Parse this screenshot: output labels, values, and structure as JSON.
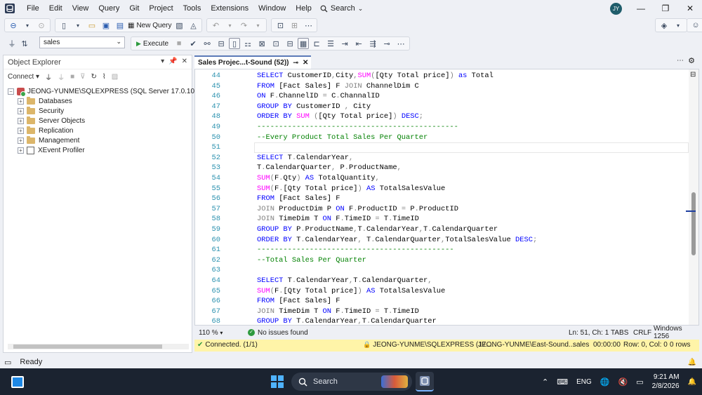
{
  "menu": [
    "File",
    "Edit",
    "View",
    "Query",
    "Git",
    "Project",
    "Tools",
    "Extensions",
    "Window",
    "Help"
  ],
  "search_label": "Search",
  "user_initials": "JY",
  "toolbar": {
    "new_query_label": "New Query",
    "database": "sales",
    "execute_label": "Execute"
  },
  "object_explorer": {
    "title": "Object Explorer",
    "connect_label": "Connect",
    "server": "JEONG-YUNME\\SQLEXPRESS (SQL Server 17.0.1050 - JEO",
    "nodes": [
      "Databases",
      "Security",
      "Server Objects",
      "Replication",
      "Management",
      "XEvent Profiler"
    ]
  },
  "tab_title": "Sales Projec...t-Sound (52))",
  "editor_lines": [
    {
      "n": "44",
      "t": [
        [
          "kw",
          "SELECT "
        ],
        [
          "tx",
          "CustomerID"
        ],
        [
          "gr",
          ","
        ],
        [
          "tx",
          "City"
        ],
        [
          "gr",
          ","
        ],
        [
          "fn",
          "SUM"
        ],
        [
          "gr",
          "("
        ],
        [
          "tx",
          "[Qty Total price]"
        ],
        [
          "gr",
          ") "
        ],
        [
          "kw",
          "as "
        ],
        [
          "tx",
          "Total"
        ]
      ]
    },
    {
      "n": "45",
      "t": [
        [
          "kw",
          "FROM "
        ],
        [
          "tx",
          "[Fact Sales] F "
        ],
        [
          "gr",
          "JOIN "
        ],
        [
          "tx",
          "ChannelDim C"
        ]
      ]
    },
    {
      "n": "46",
      "t": [
        [
          "kw",
          "ON "
        ],
        [
          "tx",
          "F"
        ],
        [
          "gr",
          "."
        ],
        [
          "tx",
          "ChannelID "
        ],
        [
          "gr",
          "= "
        ],
        [
          "tx",
          "C"
        ],
        [
          "gr",
          "."
        ],
        [
          "tx",
          "ChannalID"
        ]
      ]
    },
    {
      "n": "47",
      "t": [
        [
          "kw",
          "GROUP BY "
        ],
        [
          "tx",
          "CustomerID "
        ],
        [
          "gr",
          ", "
        ],
        [
          "tx",
          "City"
        ]
      ]
    },
    {
      "n": "48",
      "t": [
        [
          "kw",
          "ORDER BY "
        ],
        [
          "fn",
          "SUM "
        ],
        [
          "gr",
          "("
        ],
        [
          "tx",
          "[Qty Total price]"
        ],
        [
          "gr",
          ") "
        ],
        [
          "kw",
          "DESC"
        ],
        [
          "gr",
          ";"
        ]
      ]
    },
    {
      "n": "49",
      "t": [
        [
          "cm",
          "----------------------------------------------"
        ]
      ]
    },
    {
      "n": "50",
      "t": [
        [
          "cm",
          "--Every Product Total Sales Per Quarter"
        ]
      ]
    },
    {
      "n": "51",
      "t": []
    },
    {
      "n": "52",
      "t": [
        [
          "kw",
          "SELECT "
        ],
        [
          "tx",
          "T"
        ],
        [
          "gr",
          "."
        ],
        [
          "tx",
          "CalendarYear"
        ],
        [
          "gr",
          ","
        ]
      ]
    },
    {
      "n": "53",
      "t": [
        [
          "tx",
          "T"
        ],
        [
          "gr",
          "."
        ],
        [
          "tx",
          "CalendarQuarter"
        ],
        [
          "gr",
          ", "
        ],
        [
          "tx",
          "P"
        ],
        [
          "gr",
          "."
        ],
        [
          "tx",
          "ProductName"
        ],
        [
          "gr",
          ","
        ]
      ]
    },
    {
      "n": "54",
      "t": [
        [
          "fn",
          "SUM"
        ],
        [
          "gr",
          "("
        ],
        [
          "tx",
          "F"
        ],
        [
          "gr",
          "."
        ],
        [
          "tx",
          "Qty"
        ],
        [
          "gr",
          ") "
        ],
        [
          "kw",
          "AS "
        ],
        [
          "tx",
          "TotalQuantity"
        ],
        [
          "gr",
          ","
        ]
      ]
    },
    {
      "n": "55",
      "t": [
        [
          "fn",
          "SUM"
        ],
        [
          "gr",
          "("
        ],
        [
          "tx",
          "F"
        ],
        [
          "gr",
          "."
        ],
        [
          "tx",
          "[Qty Total price]"
        ],
        [
          "gr",
          ") "
        ],
        [
          "kw",
          "AS "
        ],
        [
          "tx",
          "TotalSalesValue"
        ]
      ]
    },
    {
      "n": "56",
      "t": [
        [
          "kw",
          "FROM "
        ],
        [
          "tx",
          "[Fact Sales] F"
        ]
      ]
    },
    {
      "n": "57",
      "t": [
        [
          "gr",
          "JOIN "
        ],
        [
          "tx",
          "ProductDim P "
        ],
        [
          "kw",
          "ON "
        ],
        [
          "tx",
          "F"
        ],
        [
          "gr",
          "."
        ],
        [
          "tx",
          "ProductID "
        ],
        [
          "gr",
          "= "
        ],
        [
          "tx",
          "P"
        ],
        [
          "gr",
          "."
        ],
        [
          "tx",
          "ProductID"
        ]
      ]
    },
    {
      "n": "58",
      "t": [
        [
          "gr",
          "JOIN "
        ],
        [
          "tx",
          "TimeDim T "
        ],
        [
          "kw",
          "ON "
        ],
        [
          "tx",
          "F"
        ],
        [
          "gr",
          "."
        ],
        [
          "tx",
          "TimeID "
        ],
        [
          "gr",
          "= "
        ],
        [
          "tx",
          "T"
        ],
        [
          "gr",
          "."
        ],
        [
          "tx",
          "TimeID"
        ]
      ]
    },
    {
      "n": "59",
      "t": [
        [
          "kw",
          "GROUP BY "
        ],
        [
          "tx",
          "P"
        ],
        [
          "gr",
          "."
        ],
        [
          "tx",
          "ProductName"
        ],
        [
          "gr",
          ","
        ],
        [
          "tx",
          "T"
        ],
        [
          "gr",
          "."
        ],
        [
          "tx",
          "CalendarYear"
        ],
        [
          "gr",
          ","
        ],
        [
          "tx",
          "T"
        ],
        [
          "gr",
          "."
        ],
        [
          "tx",
          "CalendarQuarter"
        ]
      ]
    },
    {
      "n": "60",
      "t": [
        [
          "kw",
          "ORDER BY "
        ],
        [
          "tx",
          "T"
        ],
        [
          "gr",
          "."
        ],
        [
          "tx",
          "CalendarYear"
        ],
        [
          "gr",
          ", "
        ],
        [
          "tx",
          "T"
        ],
        [
          "gr",
          "."
        ],
        [
          "tx",
          "CalendarQuarter"
        ],
        [
          "gr",
          ","
        ],
        [
          "tx",
          "TotalSalesValue "
        ],
        [
          "kw",
          "DESC"
        ],
        [
          "gr",
          ";"
        ]
      ]
    },
    {
      "n": "61",
      "t": [
        [
          "cm",
          "---------------------------------------------"
        ]
      ]
    },
    {
      "n": "62",
      "t": [
        [
          "cm",
          "--Total Sales Per Quarter"
        ]
      ]
    },
    {
      "n": "63",
      "t": []
    },
    {
      "n": "64",
      "t": [
        [
          "kw",
          "SELECT "
        ],
        [
          "tx",
          "T"
        ],
        [
          "gr",
          "."
        ],
        [
          "tx",
          "CalendarYear"
        ],
        [
          "gr",
          ","
        ],
        [
          "tx",
          "T"
        ],
        [
          "gr",
          "."
        ],
        [
          "tx",
          "CalendarQuarter"
        ],
        [
          "gr",
          ","
        ]
      ]
    },
    {
      "n": "65",
      "t": [
        [
          "fn",
          "SUM"
        ],
        [
          "gr",
          "("
        ],
        [
          "tx",
          "F"
        ],
        [
          "gr",
          "."
        ],
        [
          "tx",
          "[Qty Total price]"
        ],
        [
          "gr",
          ") "
        ],
        [
          "kw",
          "AS "
        ],
        [
          "tx",
          "TotalSalesValue"
        ]
      ]
    },
    {
      "n": "66",
      "t": [
        [
          "kw",
          "FROM "
        ],
        [
          "tx",
          "[Fact Sales] F"
        ]
      ]
    },
    {
      "n": "67",
      "t": [
        [
          "gr",
          "JOIN "
        ],
        [
          "tx",
          "TimeDim T "
        ],
        [
          "kw",
          "ON "
        ],
        [
          "tx",
          "F"
        ],
        [
          "gr",
          "."
        ],
        [
          "tx",
          "TimeID "
        ],
        [
          "gr",
          "= "
        ],
        [
          "tx",
          "T"
        ],
        [
          "gr",
          "."
        ],
        [
          "tx",
          "TimeID"
        ]
      ]
    },
    {
      "n": "68",
      "t": [
        [
          "kw",
          "GROUP BY "
        ],
        [
          "tx",
          "T"
        ],
        [
          "gr",
          "."
        ],
        [
          "tx",
          "CalendarYear"
        ],
        [
          "gr",
          ","
        ],
        [
          "tx",
          "T"
        ],
        [
          "gr",
          "."
        ],
        [
          "tx",
          "CalendarQuarter"
        ]
      ]
    }
  ],
  "editor_status": {
    "zoom": "110 %",
    "issues": "No issues found",
    "position": "Ln: 51, Ch: 1",
    "tabs": "TABS",
    "eol": "CRLF",
    "encoding": "Windows 1256"
  },
  "query_status": {
    "connected": "Connected. (1/1)",
    "server": "JEONG-YUNME\\SQLEXPRESS (17....",
    "login": "JEONG-YUNME\\East-Sound...",
    "database": "sales",
    "elapsed": "00:00:00",
    "rowcol": "Row: 0, Col: 0",
    "rows": "0 rows"
  },
  "status_ready": "Ready",
  "taskbar": {
    "search": "Search",
    "language": "ENG",
    "time": "9:21 AM",
    "date": "2/8/2026"
  },
  "colors": {
    "keyword": "#0000ff",
    "function": "#ff00ff",
    "operator": "#808080",
    "comment": "#008000",
    "line_number": "#2b91af",
    "query_status_bg": "#fff4a8"
  }
}
